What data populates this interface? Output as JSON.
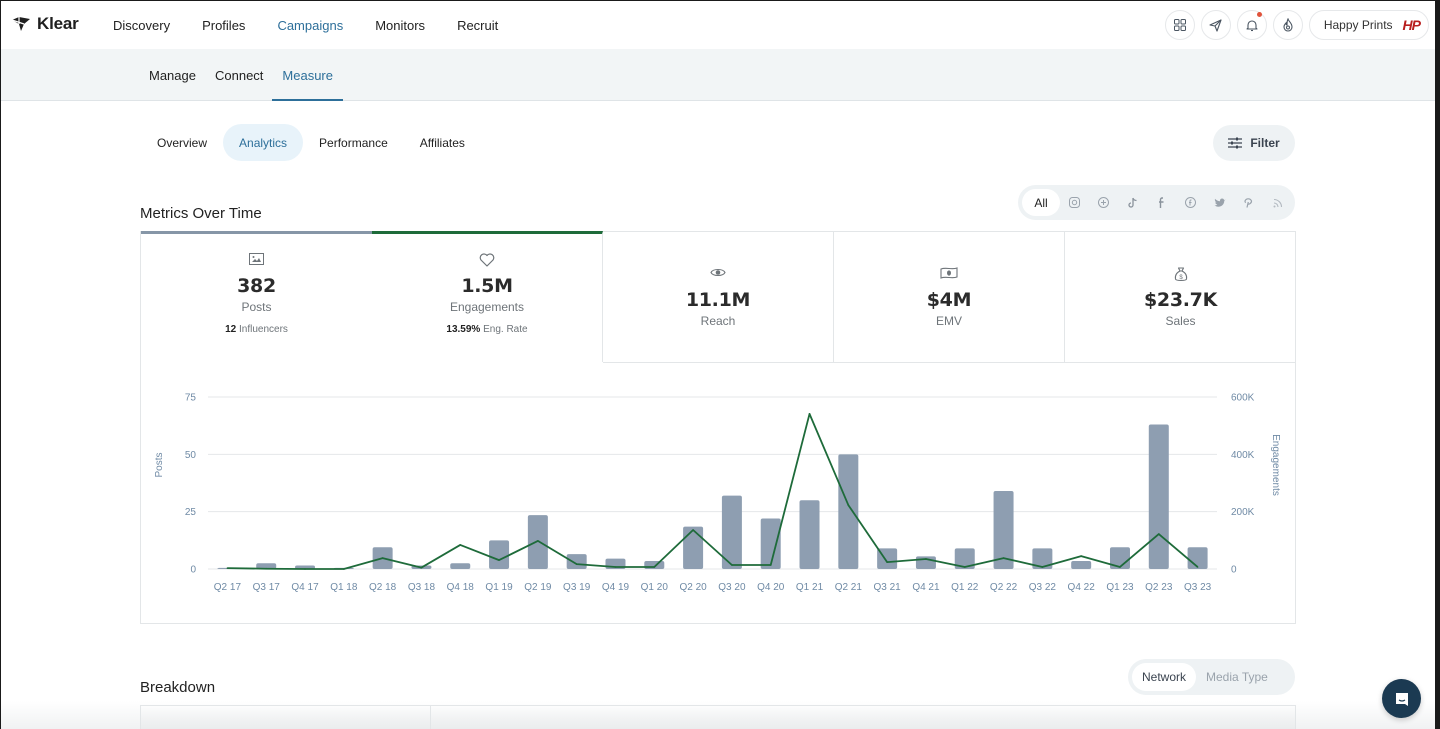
{
  "app": {
    "logo_text": "Klear"
  },
  "topnav": {
    "links": [
      {
        "label": "Discovery",
        "active": false
      },
      {
        "label": "Profiles",
        "active": false
      },
      {
        "label": "Campaigns",
        "active": true
      },
      {
        "label": "Monitors",
        "active": false
      },
      {
        "label": "Recruit",
        "active": false
      }
    ],
    "icons": [
      "apps-grid-icon",
      "send-icon",
      "bell-icon",
      "flame-icon"
    ],
    "account_name": "Happy Prints",
    "account_logo": "HP"
  },
  "subnav": {
    "items": [
      {
        "label": "Manage",
        "active": false
      },
      {
        "label": "Connect",
        "active": false
      },
      {
        "label": "Measure",
        "active": true
      }
    ]
  },
  "tabs": [
    {
      "label": "Overview",
      "active": false
    },
    {
      "label": "Analytics",
      "active": true
    },
    {
      "label": "Performance",
      "active": false
    },
    {
      "label": "Affiliates",
      "active": false
    }
  ],
  "filter_label": "Filter",
  "metrics_title": "Metrics Over Time",
  "network_filter": {
    "all_label": "All",
    "networks": [
      "instagram-icon",
      "threads-icon",
      "tiktok-icon",
      "facebook-icon",
      "facebook-circle-icon",
      "twitter-icon",
      "pinterest-icon",
      "rss-icon"
    ]
  },
  "metrics": [
    {
      "id": "posts",
      "icon": "image-icon",
      "value": "382",
      "label": "Posts",
      "sub_value": "12",
      "sub_label": "Influencers"
    },
    {
      "id": "engagements",
      "icon": "heart-icon",
      "value": "1.5M",
      "label": "Engagements",
      "sub_value": "13.59%",
      "sub_label": "Eng. Rate"
    },
    {
      "id": "reach",
      "icon": "eye-icon",
      "value": "11.1M",
      "label": "Reach"
    },
    {
      "id": "emv",
      "icon": "banknote-icon",
      "value": "$4M",
      "label": "EMV"
    },
    {
      "id": "sales",
      "icon": "money-bag-icon",
      "value": "$23.7K",
      "label": "Sales"
    }
  ],
  "colors": {
    "accent": "#2d6f9a",
    "bar": "#8e9eb1",
    "line": "#1e6b3a",
    "axis_text": "#6f8aa5"
  },
  "chart_data": {
    "type": "bar",
    "title": "",
    "categories": [
      "Q2 17",
      "Q3 17",
      "Q4 17",
      "Q1 18",
      "Q2 18",
      "Q3 18",
      "Q4 18",
      "Q1 19",
      "Q2 19",
      "Q3 19",
      "Q4 19",
      "Q1 20",
      "Q2 20",
      "Q3 20",
      "Q4 20",
      "Q1 21",
      "Q2 21",
      "Q3 21",
      "Q4 21",
      "Q1 22",
      "Q2 22",
      "Q3 22",
      "Q4 22",
      "Q1 23",
      "Q2 23",
      "Q3 23"
    ],
    "series": [
      {
        "name": "Posts",
        "type": "bar",
        "axis": "left",
        "values": [
          0.5,
          2.5,
          1.5,
          0.5,
          9.5,
          1.5,
          2.5,
          12.5,
          23.5,
          6.5,
          4.5,
          3.5,
          18.5,
          32,
          22,
          30,
          50,
          9,
          5.5,
          9,
          34,
          9,
          3.5,
          9.5,
          63,
          9.5
        ]
      },
      {
        "name": "Engagements",
        "type": "line",
        "axis": "right",
        "values": [
          3000,
          1000,
          0,
          0,
          38000,
          5000,
          84000,
          31000,
          98000,
          17000,
          7000,
          7000,
          136000,
          14000,
          14000,
          541000,
          223000,
          24000,
          35000,
          7000,
          38000,
          7000,
          45000,
          7000,
          122000,
          7000
        ]
      }
    ],
    "ylabel": "Posts",
    "ylabel_right": "Engagements",
    "ylim": [
      0,
      75
    ],
    "ylim_right": [
      0,
      600000
    ],
    "yticks": [
      "0",
      "25",
      "50",
      "75"
    ],
    "yticks_right": [
      "0",
      "200K",
      "400K",
      "600K"
    ],
    "grid": true,
    "legend": "none"
  },
  "breakdown": {
    "title": "Breakdown",
    "options": [
      {
        "label": "Network",
        "active": true
      },
      {
        "label": "Media Type",
        "active": false
      }
    ]
  }
}
